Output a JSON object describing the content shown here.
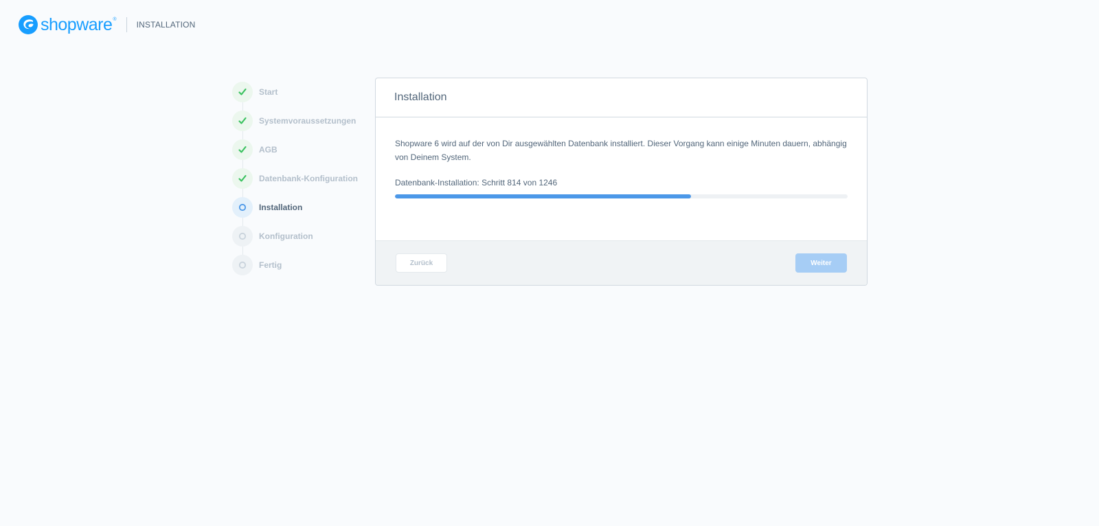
{
  "header": {
    "logo_text": "shopware",
    "logo_mark": "®",
    "title": "INSTALLATION"
  },
  "steps": [
    {
      "label": "Start",
      "state": "done",
      "icon": "checkmark-icon"
    },
    {
      "label": "Systemvoraussetzungen",
      "state": "done",
      "icon": "checkmark-icon"
    },
    {
      "label": "AGB",
      "state": "done",
      "icon": "checkmark-icon"
    },
    {
      "label": "Datenbank-Konfiguration",
      "state": "done",
      "icon": "checkmark-icon"
    },
    {
      "label": "Installation",
      "state": "active",
      "icon": "circle-icon"
    },
    {
      "label": "Konfiguration",
      "state": "pending",
      "icon": "circle-icon"
    },
    {
      "label": "Fertig",
      "state": "pending",
      "icon": "circle-icon"
    }
  ],
  "card": {
    "title": "Installation",
    "description": "Shopware 6 wird auf der von Dir ausgewählten Datenbank installiert. Dieser Vorgang kann einige Minuten dauern, abhängig von Deinem System.",
    "progress_label": "Datenbank-Installation: Schritt 814 von 1246",
    "progress_current": 814,
    "progress_total": 1246
  },
  "footer": {
    "back_label": "Zurück",
    "next_label": "Weiter"
  },
  "colors": {
    "brand": "#189eff",
    "check": "#3cc261",
    "active": "#4c98e8",
    "progress": "#4c98e8",
    "button_disabled": "#a6cdf5"
  }
}
